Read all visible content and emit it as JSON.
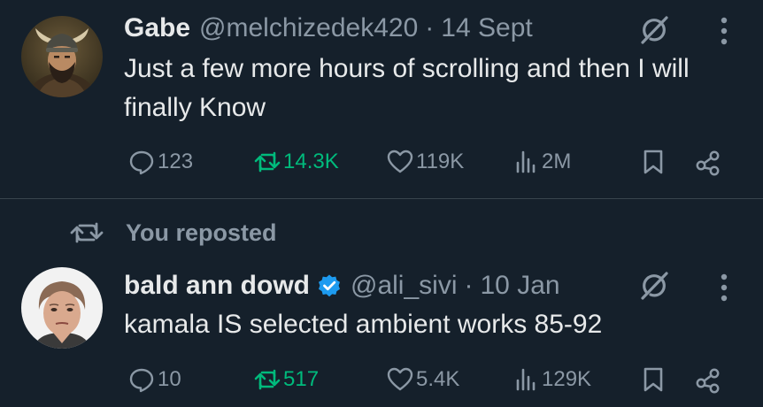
{
  "colors": {
    "background": "#15202b",
    "text_primary": "#e7e9ea",
    "text_secondary": "#8b98a5",
    "retweet_active": "#00ba7c",
    "verified": "#1d9bf0",
    "divider": "#38444d"
  },
  "tweets": [
    {
      "author_name": "Gabe",
      "handle": "@melchizedek420",
      "separator": "·",
      "timestamp": "14 Sept",
      "verified": false,
      "text": "Just a few more hours of scrolling and then I will finally Know",
      "stats": {
        "replies": "123",
        "reposts": "14.3K",
        "likes": "119K",
        "views": "2M"
      },
      "reposted_by_you": true,
      "avatar_icon": "horned-helmet-warrior-avatar"
    },
    {
      "repost_context": "You reposted",
      "author_name": "bald ann dowd",
      "handle": "@ali_sivi",
      "separator": "·",
      "timestamp": "10 Jan",
      "verified": true,
      "text": "kamala IS selected ambient works 85-92",
      "stats": {
        "replies": "10",
        "reposts": "517",
        "likes": "5.4K",
        "views": "129K"
      },
      "reposted_by_you": true,
      "avatar_icon": "portrait-avatar"
    }
  ]
}
